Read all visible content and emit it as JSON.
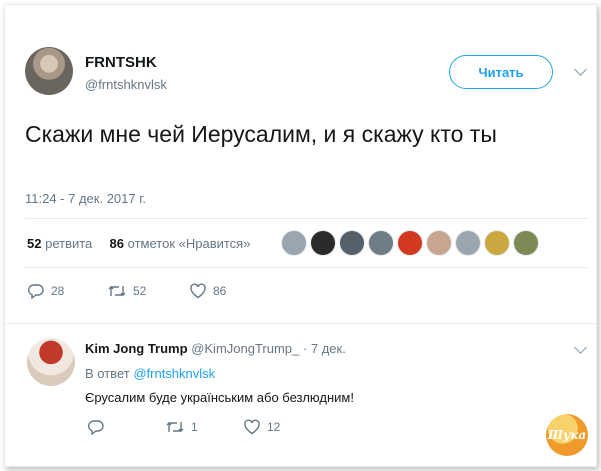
{
  "tweet": {
    "author_name": "FRNTSHK",
    "author_handle": "@frntshknvlsk",
    "follow_label": "Читать",
    "text": "Скажи мне чей Иерусалим, и я скажу кто ты",
    "timestamp": "11:24 - 7 дек. 2017 г.",
    "retweets_count": "52",
    "retweets_label": "ретвита",
    "likes_count": "86",
    "likes_label": "отметок «Нравится»",
    "actions": {
      "reply_count": "28",
      "retweet_count": "52",
      "like_count": "86"
    }
  },
  "reply": {
    "author_name": "Kim Jong Trump",
    "author_handle": "@KimJongTrump_",
    "date": "· 7 дек.",
    "in_reply_prefix": "В ответ",
    "in_reply_handle": "@frntshknvlsk",
    "text": "Єрусалим буде українським або безлюдним!",
    "actions": {
      "reply_count": "",
      "retweet_count": "1",
      "like_count": "12"
    }
  },
  "watermark": "Шука",
  "colors": {
    "accent": "#1da1f2",
    "muted": "#657786",
    "border": "#e6ecf0"
  },
  "likers": [
    "#9aa5ad",
    "#2b2b2b",
    "#55606b",
    "#6f7d86",
    "#d3391f",
    "#c8a58f",
    "#9aa5ad",
    "#c9a840",
    "#7c8a55"
  ]
}
